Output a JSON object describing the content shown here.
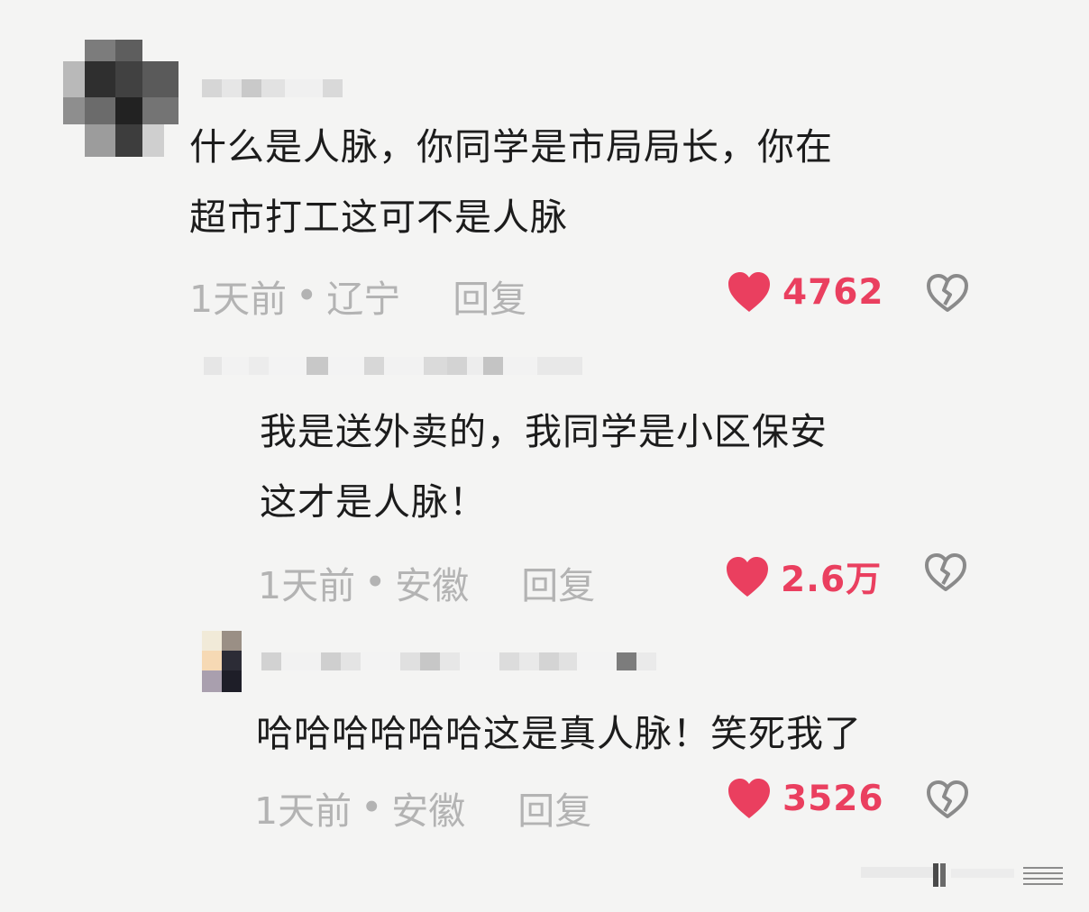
{
  "comments": [
    {
      "text_line1": "什么是人脉，你同学是市局局长，你在",
      "text_line2": "超市打工这可不是人脉",
      "time": "1天前",
      "separator": "•",
      "location": "辽宁",
      "reply_label": "回复",
      "likes": "4762"
    },
    {
      "text_line1": "我是送外卖的，我同学是小区保安",
      "text_line2": "这才是人脉！",
      "time": "1天前",
      "separator": "•",
      "location": "安徽",
      "reply_label": "回复",
      "likes": "2.6万"
    },
    {
      "text_line1": "哈哈哈哈哈哈这是真人脉！笑死我了",
      "time": "1天前",
      "separator": "•",
      "location": "安徽",
      "reply_label": "回复",
      "likes": "3526"
    }
  ],
  "icons": {
    "like": "heart-filled-icon",
    "dislike": "broken-heart-icon"
  },
  "colors": {
    "background": "#f4f4f3",
    "text": "#1c1c1c",
    "meta": "#b3b3b3",
    "like": "#ea3f5f",
    "dislike_outline": "#8a8a8a"
  }
}
